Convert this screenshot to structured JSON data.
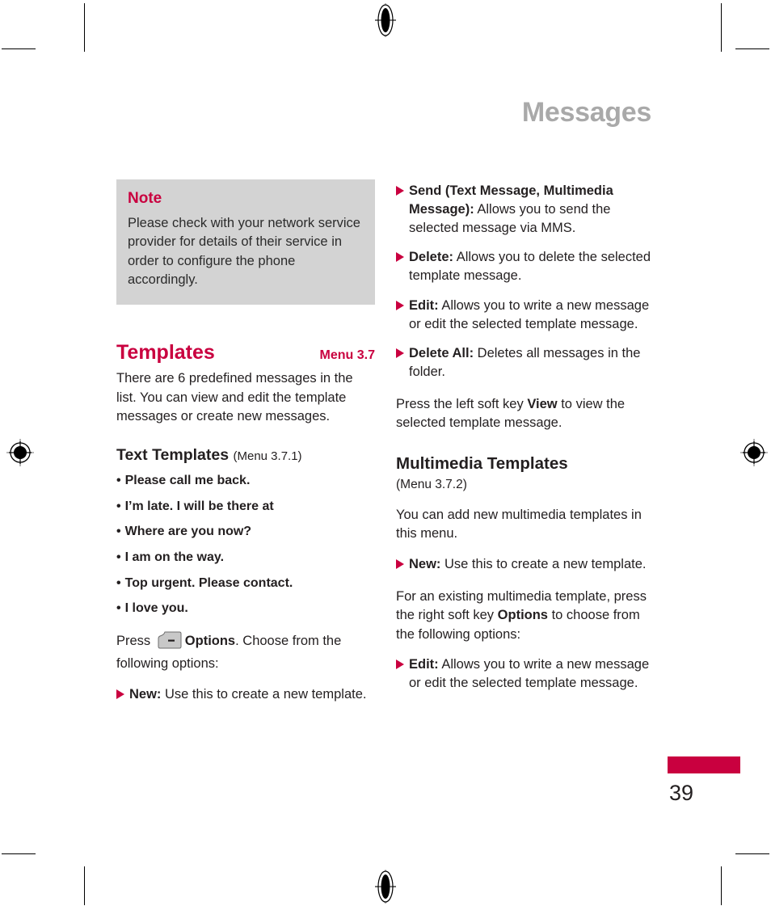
{
  "chapter": {
    "title": "Messages"
  },
  "note": {
    "title": "Note",
    "body": "Please check with your network service provider for details of their service in order to configure the phone accordingly."
  },
  "templates_section": {
    "title": "Templates",
    "menu_number": "Menu 3.7",
    "intro": "There are 6 predefined messages in the list. You can view and edit the template messages or create new messages."
  },
  "text_templates": {
    "heading": "Text Templates",
    "menu_ref": "(Menu 3.7.1)",
    "items": [
      "Please call me back.",
      "I’m late. I will be there at",
      "Where are you now?",
      "I am on the way.",
      "Top urgent. Please contact.",
      "I love you."
    ],
    "press_prefix": "Press",
    "press_key_label": "Options",
    "press_suffix": ". Choose from the following options:",
    "options": [
      {
        "label": "New:",
        "desc": " Use this to create a new template."
      }
    ]
  },
  "right_column": {
    "options": [
      {
        "label": "Send (Text Message, Multimedia Message):",
        "desc": " Allows you to send the selected message via MMS."
      },
      {
        "label": "Delete:",
        "desc": " Allows you to delete the selected template message."
      },
      {
        "label": "Edit:",
        "desc": " Allows you to write a new message or edit the selected template message."
      },
      {
        "label": "Delete All:",
        "desc": " Deletes all messages in the folder."
      }
    ],
    "view_para_pre": "Press the left soft key ",
    "view_para_key": "View",
    "view_para_post": " to view the selected template message."
  },
  "multimedia_templates": {
    "heading": "Multimedia Templates",
    "menu_ref": "(Menu 3.7.2)",
    "intro": "You can add new multimedia templates in this menu.",
    "options_new": [
      {
        "label": "New:",
        "desc": " Use this to create a new template."
      }
    ],
    "existing_pre": "For an existing multimedia template, press the right soft key ",
    "existing_key": "Options",
    "existing_post": " to choose from the following options:",
    "options_edit": [
      {
        "label": "Edit:",
        "desc": " Allows you to write a new message or edit the selected template message."
      }
    ]
  },
  "footer": {
    "page_number": "39"
  },
  "colors": {
    "accent": "#c9003f",
    "note_bg": "#d3d3d3",
    "chapter_gray": "#a9a9a9",
    "text": "#231f20"
  }
}
